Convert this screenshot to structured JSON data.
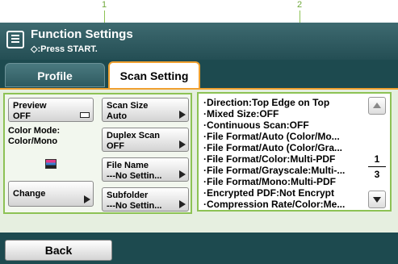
{
  "callouts": {
    "left": "1",
    "right": "2"
  },
  "header": {
    "title": "Function Settings",
    "subtitle": "◇:Press START."
  },
  "tabs": [
    {
      "label": "Profile"
    },
    {
      "label": "Scan Setting"
    }
  ],
  "preview": {
    "label": "Preview",
    "value": "OFF"
  },
  "color_mode": {
    "label": "Color Mode:",
    "value": "Color/Mono"
  },
  "change_button": {
    "label": "Change"
  },
  "settings": [
    {
      "label": "Scan Size",
      "value": "Auto"
    },
    {
      "label": "Duplex Scan",
      "value": "OFF"
    },
    {
      "label": "File Name",
      "value": "---No Settin..."
    },
    {
      "label": "Subfolder",
      "value": "---No Settin..."
    }
  ],
  "summary_list": [
    "·Direction:Top Edge on Top",
    "·Mixed Size:OFF",
    "·Continuous Scan:OFF",
    "·File Format/Auto (Color/Mo...",
    "·File Format/Auto (Color/Gra...",
    "·File Format/Color:Multi-PDF",
    "·File Format/Grayscale:Multi-...",
    "·File Format/Mono:Multi-PDF",
    "·Encrypted PDF:Not Encrypt",
    "·Compression Rate/Color:Me..."
  ],
  "pagination": {
    "current": "1",
    "total": "3"
  },
  "footer": {
    "back_label": "Back"
  },
  "colors": {
    "accent": "#f0a030",
    "group_border": "#8dc255",
    "panel_bg": "#1d4a4f"
  },
  "icons": [
    "list-menu-icon",
    "start-icon",
    "preview-toggle-icon",
    "color-mode-icon",
    "arrow-right-icon",
    "scroll-up-icon",
    "scroll-down-icon"
  ]
}
